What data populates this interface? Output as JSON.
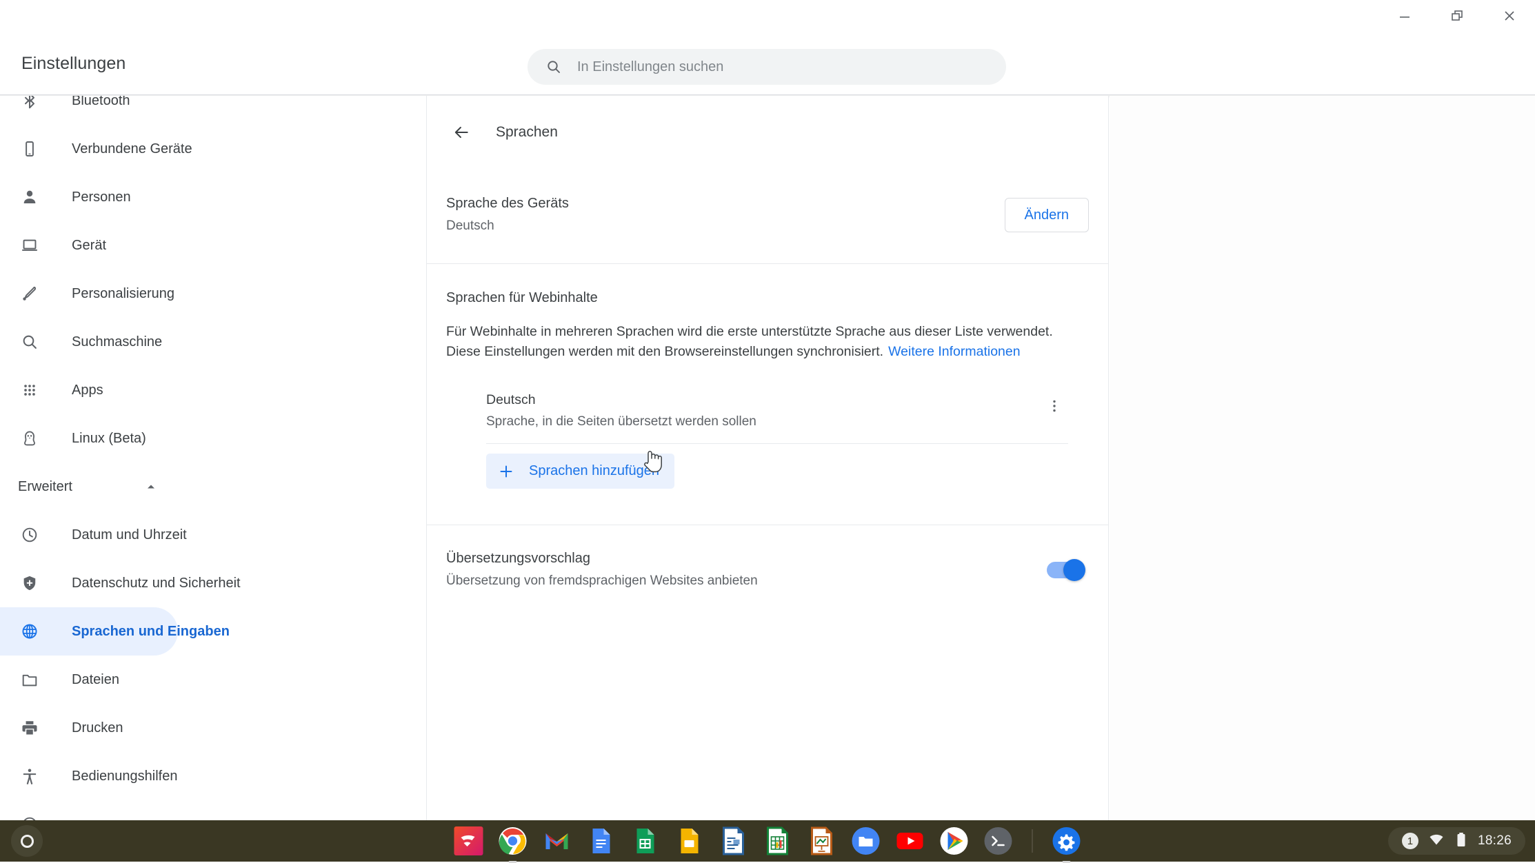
{
  "window": {
    "minimize_label": "Minimieren",
    "maximize_label": "Maximieren",
    "close_label": "Schließen"
  },
  "app": {
    "title": "Einstellungen"
  },
  "search": {
    "placeholder": "In Einstellungen suchen",
    "value": ""
  },
  "sidebar": {
    "items": [
      {
        "label": "Bluetooth",
        "icon": "bluetooth-icon",
        "selected": false
      },
      {
        "label": "Verbundene Geräte",
        "icon": "phone-icon",
        "selected": false
      },
      {
        "label": "Personen",
        "icon": "person-icon",
        "selected": false
      },
      {
        "label": "Gerät",
        "icon": "laptop-icon",
        "selected": false
      },
      {
        "label": "Personalisierung",
        "icon": "brush-icon",
        "selected": false
      },
      {
        "label": "Suchmaschine",
        "icon": "search-icon",
        "selected": false
      },
      {
        "label": "Apps",
        "icon": "grid-icon",
        "selected": false
      },
      {
        "label": "Linux (Beta)",
        "icon": "penguin-icon",
        "selected": false
      }
    ],
    "advanced_group": {
      "label": "Erweitert",
      "expanded": true,
      "items": [
        {
          "label": "Datum und Uhrzeit",
          "icon": "clock-icon",
          "selected": false
        },
        {
          "label": "Datenschutz und Sicherheit",
          "icon": "shield-icon",
          "selected": false
        },
        {
          "label": "Sprachen und Eingaben",
          "icon": "globe-icon",
          "selected": true
        },
        {
          "label": "Dateien",
          "icon": "folder-icon",
          "selected": false
        },
        {
          "label": "Drucken",
          "icon": "printer-icon",
          "selected": false
        },
        {
          "label": "Bedienungshilfen",
          "icon": "accessibility-icon",
          "selected": false
        }
      ]
    }
  },
  "main": {
    "page_title": "Sprachen",
    "back_label": "Zurück",
    "device_language": {
      "title": "Sprache des Geräts",
      "value": "Deutsch",
      "change_button": "Ändern"
    },
    "web_content": {
      "title": "Sprachen für Webinhalte",
      "description": "Für Webinhalte in mehreren Sprachen wird die erste unterstützte Sprache aus dieser Liste verwendet. Diese Einstellungen werden mit den Browsereinstellungen synchronisiert.",
      "learn_more": "Weitere Informationen",
      "languages": [
        {
          "name": "Deutsch",
          "description": "Sprache, in die Seiten übersetzt werden sollen",
          "menu_label": "Weitere Optionen"
        }
      ],
      "add_button": "Sprachen hinzufügen"
    },
    "translate": {
      "title": "Übersetzungsvorschlag",
      "description": "Übersetzung von fremdsprachigen Websites anbieten",
      "enabled": true
    }
  },
  "shelf": {
    "launcher_label": "Launcher",
    "apps": [
      {
        "name": "Stadia",
        "running": false
      },
      {
        "name": "Google Chrome",
        "running": true
      },
      {
        "name": "Gmail",
        "running": false
      },
      {
        "name": "Google Docs",
        "running": false
      },
      {
        "name": "Google Tabellen",
        "running": false
      },
      {
        "name": "Google Präsentationen",
        "running": false
      },
      {
        "name": "LibreOffice Writer",
        "running": false
      },
      {
        "name": "LibreOffice Calc",
        "running": false
      },
      {
        "name": "LibreOffice Impress",
        "running": false
      },
      {
        "name": "Dateien",
        "running": false
      },
      {
        "name": "YouTube",
        "running": false
      },
      {
        "name": "Play Store",
        "running": false
      },
      {
        "name": "Terminal",
        "running": false
      },
      {
        "name": "Einstellungen",
        "running": true
      }
    ],
    "status": {
      "notification_count": "1",
      "wifi_label": "WLAN",
      "battery_label": "Akku",
      "time": "18:26"
    }
  },
  "colors": {
    "accent": "#1a73e8",
    "accent_light": "#8ab4f8",
    "selected_bg": "#e8f0fe",
    "shelf_bg": "#3a3723",
    "text_primary": "#3c4043",
    "text_secondary": "#5f6368"
  }
}
